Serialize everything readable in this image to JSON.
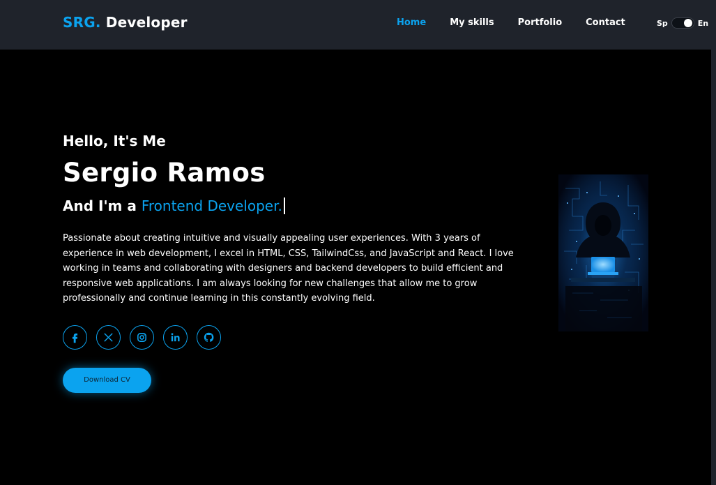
{
  "header": {
    "logo_accent": "SRG.",
    "logo_text": " Developer",
    "nav": [
      {
        "label": "Home",
        "active": true
      },
      {
        "label": "My skills"
      },
      {
        "label": "Portfolio"
      },
      {
        "label": "Contact"
      }
    ],
    "lang_left": "Sp",
    "lang_right": "En"
  },
  "hero": {
    "greeting": "Hello, It's Me",
    "name": "Sergio Ramos",
    "role_prefix": "And I'm a ",
    "role_highlight": "Frontend Developer.",
    "bio": "Passionate about creating intuitive and visually appealing user experiences. With 3 years of experience in web development, I excel in HTML, CSS, TailwindCss, and JavaScript and React. I love working in teams and collaborating with designers and backend developers to build efficient and responsive web applications. I am always looking for new challenges that allow me to grow professionally and continue learning in this constantly evolving field.",
    "socials": [
      "facebook-icon",
      "x-icon",
      "instagram-icon",
      "linkedin-icon",
      "github-icon"
    ],
    "cv_button": "Download CV"
  },
  "colors": {
    "accent": "#0ba3ef",
    "header_bg": "#1f232b",
    "page_bg": "#000000"
  }
}
